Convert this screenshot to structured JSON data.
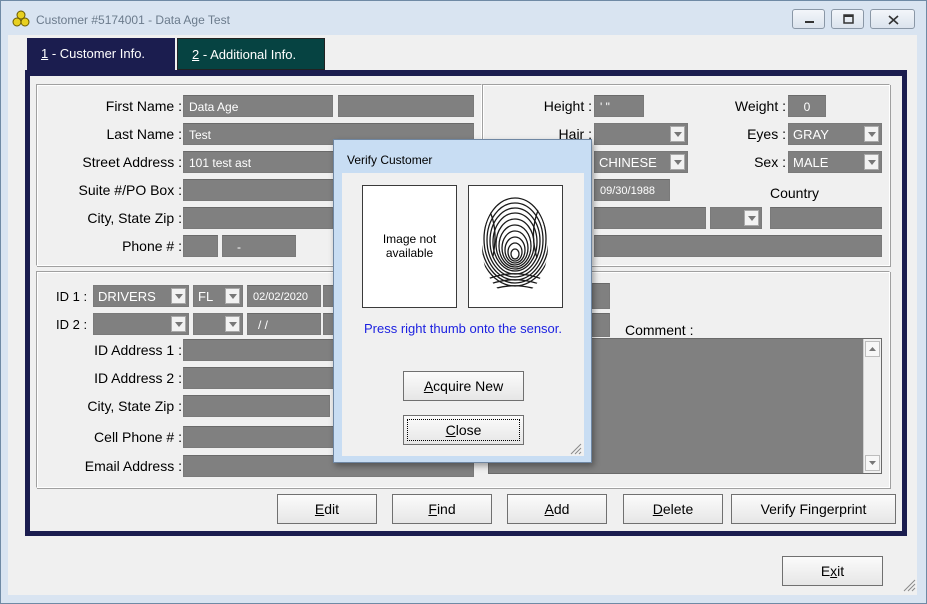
{
  "window": {
    "title": "Customer #5174001 - Data Age Test"
  },
  "tabs": [
    {
      "key": "1",
      "label": " - Customer Info."
    },
    {
      "key": "2",
      "label": " - Additional Info."
    }
  ],
  "personal": {
    "first_name_label": "First Name :",
    "first_name_value": "Data Age",
    "middle_value": "",
    "last_name_label": "Last Name :",
    "last_name_value": "Test",
    "street_label": "Street Address :",
    "street_value": "101 test ast",
    "suite_label": "Suite #/PO Box :",
    "suite_value": "",
    "city_label": "City, State Zip :",
    "phone_label": "Phone # :",
    "phone_area": "",
    "phone_number": "-"
  },
  "physical": {
    "height_label": "Height :",
    "height_value": "'  \"",
    "weight_label": "Weight :",
    "weight_value": "0",
    "hair_label": "Hair :",
    "hair_value": "",
    "eyes_label": "Eyes :",
    "eyes_value": "GRAY",
    "race_value": "CHINESE",
    "sex_label": "Sex :",
    "sex_value": "MALE",
    "dob_value": "09/30/1988",
    "country_label": "Country"
  },
  "ids": {
    "id1_label": "ID 1 :",
    "id1_type": "DRIVERS",
    "id1_state": "FL",
    "id1_date": "02/02/2020",
    "id2_label": "ID 2 :",
    "id2_type": "",
    "id2_state": "",
    "id2_date": "/ /",
    "id_address1_label": "ID Address 1 :",
    "id_address2_label": "ID Address 2 :",
    "id_city_label": "City, State Zip :",
    "cell_label": "Cell Phone # :",
    "email_label": "Email Address :",
    "comment_label": "Comment :"
  },
  "buttons": {
    "edit": {
      "u": "E",
      "rest": "dit"
    },
    "find": {
      "u": "F",
      "rest": "ind"
    },
    "add": {
      "u": "A",
      "rest": "dd"
    },
    "delete": {
      "u": "D",
      "rest": "elete"
    },
    "verify": {
      "pre": "Verify Fin",
      "u": "g",
      "rest": "erprint"
    },
    "exit": {
      "pre": "E",
      "u": "x",
      "rest": "it"
    }
  },
  "dialog": {
    "title": "Verify Customer",
    "image_placeholder": "Image not available",
    "prompt": "Press right thumb onto the sensor.",
    "acquire": {
      "u": "A",
      "rest": "cquire New"
    },
    "close": {
      "u": "C",
      "rest": "lose"
    }
  },
  "colors": {
    "tab_frame": "#1b1d4f",
    "tab_additional": "#064342",
    "field_gray": "#808080",
    "prompt_blue": "#1a1fe0"
  }
}
